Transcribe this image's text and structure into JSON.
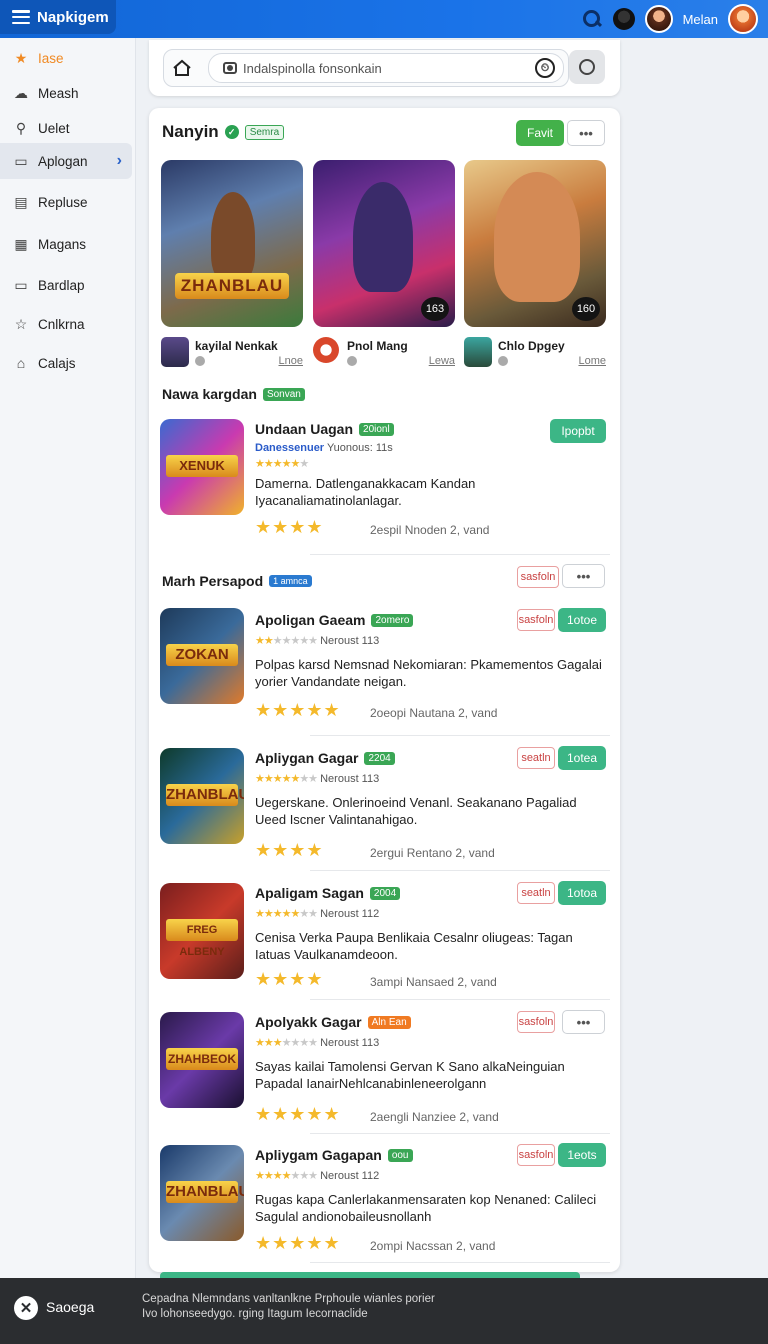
{
  "topbar": {
    "brand": "Napkigem",
    "user": "Melan"
  },
  "sidebar": {
    "items": [
      {
        "label": "Iase",
        "icon": "star-icon"
      },
      {
        "label": "Meash",
        "icon": "cloud-icon"
      },
      {
        "label": "Uelet",
        "icon": "badge-icon"
      },
      {
        "label": "Aplogan",
        "icon": "play-icon"
      },
      {
        "label": "Repluse",
        "icon": "document-icon"
      },
      {
        "label": "Magans",
        "icon": "grid-icon"
      },
      {
        "label": "Bardlap",
        "icon": "tray-icon"
      },
      {
        "label": "Cnlkrna",
        "icon": "star-outline-icon"
      },
      {
        "label": "Calajs",
        "icon": "tag-icon"
      }
    ]
  },
  "search": {
    "placeholder": "Indalspinolla fonsonkain"
  },
  "featured": {
    "title": "Nanyin",
    "badge": "Semra",
    "follow_label": "Favit",
    "more_label": "•••",
    "tiles": [
      {
        "logo": "ZHANBLAU",
        "chip": ""
      },
      {
        "logo": "",
        "chip": "163"
      },
      {
        "logo": "",
        "chip": "160"
      }
    ],
    "meta": [
      {
        "name": "kayilal Nenkak",
        "link": "Lnoe"
      },
      {
        "name": "Pnol Mang",
        "link": "Lewa"
      },
      {
        "name": "Chlo Dpgey",
        "link": "Lome"
      }
    ]
  },
  "new_section": {
    "title": "Nawa kargdan",
    "badge": "Sonvan"
  },
  "highlight": {
    "title": "Undaan Uagan",
    "pill": "20ionl",
    "developer": "Danessenuer",
    "meta": "Yuonous: 11s",
    "desc": "Damerna. Datlenganakkacam Kandan Iyacanaliamatinolanlagar.",
    "date": "2espil Nnoden 2, vand",
    "action": "Ipopbt"
  },
  "popular": {
    "title": "Marh Persapod",
    "badge": "1 amnca",
    "filter_label": "sasfoln",
    "more_label": "•••"
  },
  "list": [
    {
      "title": "Apoligan Gaeam",
      "pill": "2omero",
      "pill_color": "green",
      "meta": "Neroust 113",
      "desc": "Polpas karsd Nemsnad Nekomiaran: Pkamementos Gagalai yorier Vandandate neigan.",
      "date": "2oeopi Nautana 2, vand",
      "red": "sasfoln",
      "action": "1otoe",
      "stars": 2,
      "logo": "ZOKAN"
    },
    {
      "title": "Apliygan Gagar",
      "pill": "2204",
      "pill_color": "green",
      "meta": "Neroust 113",
      "desc": "Uegerskane. Onlerinoeind Venanl. Seakanano Pagaliad Ueed Iscner Valintanahigao.",
      "date": "2ergui Rentano 2, vand",
      "red": "seatln",
      "action": "1otea",
      "stars": 4,
      "logo": "ZHANBLAU"
    },
    {
      "title": "Apaligam Sagan",
      "pill": "2004",
      "pill_color": "green",
      "meta": "Neroust 112",
      "desc": "Cenisa Verka Paupa Benlikaia Cesalnr oliugeas: Tagan Iatuas Vaulkanamdeoon.",
      "date": "3ampi Nansaed 2, vand",
      "red": "seatln",
      "action": "1otoa",
      "stars": 5,
      "logo": "FREG ALBENY"
    },
    {
      "title": "Apolyakk Gagar",
      "pill": "Aln Ean",
      "pill_color": "orange",
      "meta": "Neroust 113",
      "desc": "Sayas kailai Tamolensi Gervan K Sano alkaNeinguian Papadal IanairNehlcanabinleneerolgann",
      "date": "2aengli Nanziee 2, vand",
      "red": "sasfoln",
      "action": "•••",
      "stars": 3,
      "logo": "ZHAHBEOK"
    },
    {
      "title": "Apliygam Gagapan",
      "pill": "oou",
      "pill_color": "green",
      "meta": "Neroust 112",
      "desc": "Rugas kapa Canlerlakanmensaraten kop Nenaned: Calileci Sagulal andionobaileusnollanh",
      "date": "2ompi Nacssan 2, vand",
      "red": "sasfoln",
      "action": "1eots",
      "stars": 3,
      "logo": "ZHANBLAU"
    }
  ],
  "footer": {
    "label": "Saoega",
    "text": "Cepadna Nlemndans  vanltanlkne  Prphoule wianles porier Ivo lohonseedygo. rging  Itagum Iecornaclide"
  },
  "colors": {
    "topbar": "#1a73e8",
    "accent_green": "#43b14a",
    "teal": "#3cb686",
    "star": "#f4b92b"
  }
}
